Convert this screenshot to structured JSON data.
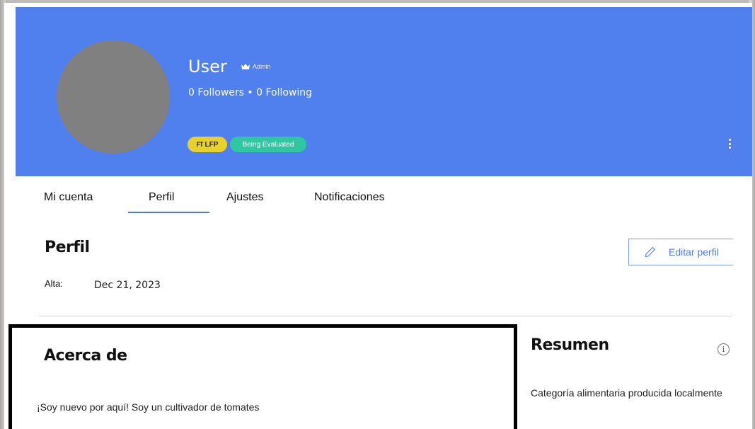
{
  "header": {
    "username": "User",
    "role": "Admin",
    "followers_line": "0 Followers • 0 Following",
    "badges": {
      "lfp_icon": "FT",
      "lfp_label": "LFP",
      "status": "Being Evaluated"
    },
    "colors": {
      "banner": "#5080ee",
      "lfp_badge": "#e8d12a",
      "status_badge": "#2fc7a0",
      "avatar": "#808080"
    }
  },
  "tabs": [
    {
      "label": "Mi cuenta"
    },
    {
      "label": "Perfil",
      "active": true
    },
    {
      "label": "Ajustes"
    },
    {
      "label": "Notificaciones"
    }
  ],
  "profile": {
    "title": "Perfil",
    "edit_label": "Editar perfil",
    "alta_label": "Alta:",
    "alta_value": "Dec 21, 2023"
  },
  "about": {
    "title": "Acerca de",
    "text": "¡Soy nuevo por aquí! Soy un cultivador de tomates"
  },
  "summary": {
    "title": "Resumen",
    "info_icon": "i",
    "text": "Categoría alimentaria producida localmente"
  },
  "icons": [
    "crown-icon",
    "lfp-icon",
    "more-icon",
    "pencil-icon",
    "info-icon"
  ]
}
